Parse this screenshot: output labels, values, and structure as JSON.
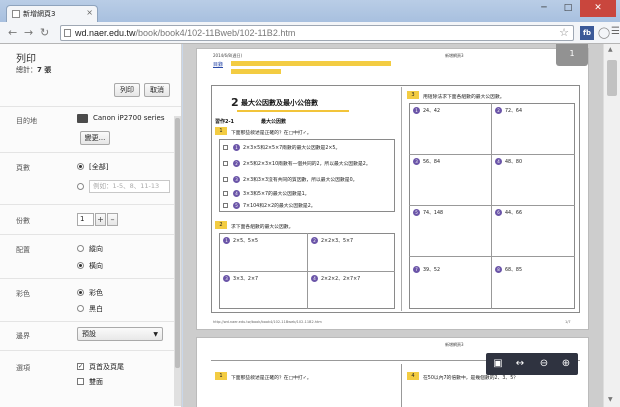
{
  "window": {
    "tab_title": "新增網頁3",
    "tab_close": "×",
    "minimize": "─",
    "maximize": "□",
    "close": "✕"
  },
  "toolbar": {
    "url_host": "wd.naer.edu.tw",
    "url_path": "/book/book4/102-11Bweb/102-11B2.htm",
    "ext_fb": "fb"
  },
  "print_panel": {
    "title": "列印",
    "total_label": "總計：",
    "total_value": "7 張",
    "print_button": "列印",
    "cancel_button": "取消",
    "destination_label": "目的地",
    "printer_name": "Canon iP2700 series",
    "change_button": "變更...",
    "pages_label": "頁數",
    "pages_all": "[全部]",
    "pages_placeholder": "例如：1-5、8、11-13",
    "copies_label": "份數",
    "copies_value": "1",
    "copies_plus": "+",
    "copies_minus": "–",
    "layout_label": "配置",
    "layout_portrait": "縱向",
    "layout_landscape": "橫向",
    "color_label": "彩色",
    "color_color": "彩色",
    "color_bw": "黑白",
    "margins_label": "邊界",
    "margins_value": "預設",
    "options_label": "選項",
    "option_header_footer": "頁首及頁尾",
    "option_duplex": "雙面"
  },
  "preview": {
    "page_number": "1",
    "page_header_left": "2014/6/8(週日)",
    "page_header_right": "新增網頁3",
    "toc_link": "目錄",
    "chapter_number": "2",
    "chapter_title": "最大公因數及最小公倍數",
    "section_tag": "習作2-1",
    "section_title": "最大公因數",
    "q1_text": "下面那些敘述是正確的？在□中打✓。",
    "q1_items": [
      "2×3×5和2×5×7兩數的最大公因數是2×5。",
      "2×5和2×3×10兩數有一個共同的2，所以最大公因數是2。",
      "2×3和3×3沒有共同的質因數，所以最大公因數是0。",
      "3×3和5×7的最大公因數是1。",
      "7×104和2×2的最大公因數是2。"
    ],
    "q2_text": "求下面各組數的最大公因數。",
    "q2_items": [
      "2×5、5×5",
      "2×2×3、5×7",
      "3×3、2×7",
      "2×2×2、2×7×7"
    ],
    "q3_text": "用短除法求下面各組數的最大公因數。",
    "q3_items": [
      "24、42",
      "72、64",
      "56、84",
      "48、80",
      "74、148",
      "44、66",
      "39、52",
      "68、85"
    ],
    "footer_left": "http://wd.naer.edu.tw/book/book4/102-11Bweb/102-11B2.htm",
    "footer_right": "1/7",
    "page2_header": "新增網頁3",
    "page2_q_left": "下面那些敘述是正確的？在□中打✓。",
    "page2_q_right": "在50以內7的倍數中，是幾個數的2、3、5？"
  }
}
